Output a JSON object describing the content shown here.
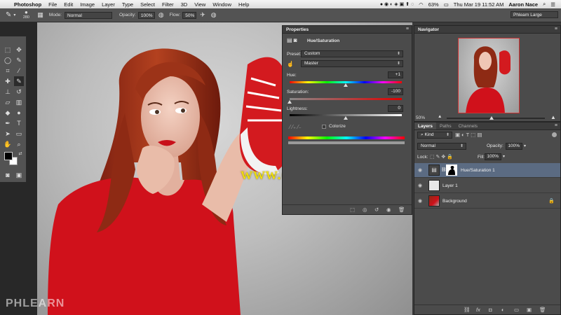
{
  "menubar": {
    "apple": "",
    "app": "Photoshop",
    "items": [
      "File",
      "Edit",
      "Image",
      "Layer",
      "Type",
      "Select",
      "Filter",
      "3D",
      "View",
      "Window",
      "Help"
    ],
    "battery": "63%",
    "clock": "Thu Mar 19  11:52 AM",
    "user": "Aaron Nace"
  },
  "options": {
    "brush_size": "280",
    "mode_label": "Mode:",
    "mode_value": "Normal",
    "opacity_label": "Opacity:",
    "opacity_value": "100%",
    "flow_label": "Flow:",
    "flow_value": "50%",
    "workspace": "Phlearn Large"
  },
  "properties": {
    "title": "Properties",
    "subtitle": "Hue/Saturation",
    "preset_label": "Preset:",
    "preset_value": "Custom",
    "channel_value": "Master",
    "hue_label": "Hue:",
    "hue_value": "+1",
    "saturation_label": "Saturation:",
    "saturation_value": "-100",
    "lightness_label": "Lightness:",
    "lightness_value": "0",
    "colorize_label": "Colorize",
    "hue_slider_pos": 0.5,
    "saturation_slider_pos": 0.0,
    "lightness_slider_pos": 0.5
  },
  "navigator": {
    "title": "Navigator",
    "zoom": "50%"
  },
  "layers": {
    "tabs": [
      "Layers",
      "Paths",
      "Channels"
    ],
    "kind_label": "Kind",
    "blend_mode": "Normal",
    "opacity_label": "Opacity:",
    "opacity_value": "100%",
    "lock_label": "Lock:",
    "fill_label": "Fill:",
    "fill_value": "100%",
    "rows": [
      {
        "name": "Hue/Saturation 1"
      },
      {
        "name": "Layer 1"
      },
      {
        "name": "Background"
      }
    ]
  },
  "watermark": "www.cgtsj.com",
  "logo": "PHLEARN",
  "colors": {
    "panel": "#4b4b4b",
    "selected_layer": "#5b6b82",
    "watermark": "#f5e400",
    "dress_red": "#d0111b"
  }
}
